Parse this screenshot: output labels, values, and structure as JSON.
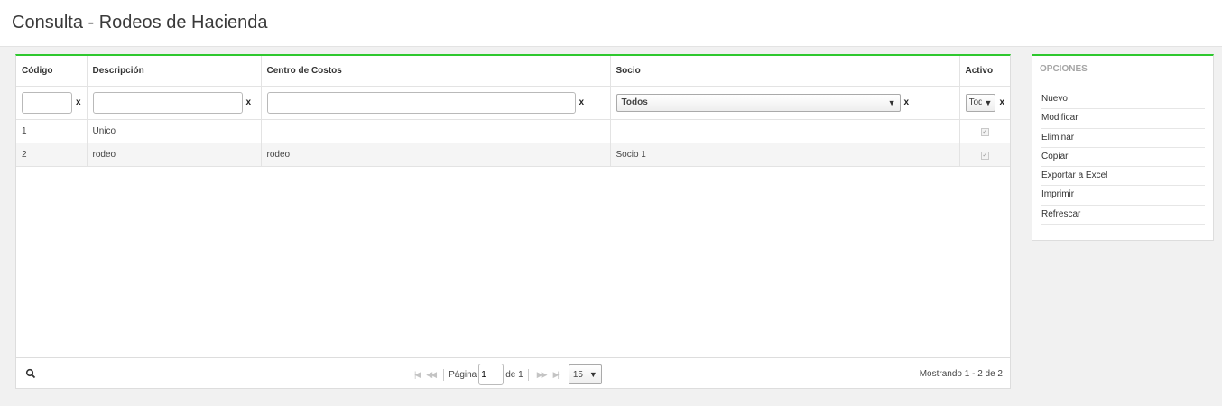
{
  "page": {
    "title": "Consulta - Rodeos de Hacienda"
  },
  "grid": {
    "columns": [
      "Código",
      "Descripción",
      "Centro de Costos",
      "Socio",
      "Activo"
    ],
    "filters": {
      "clear_label": "x",
      "socio_selected": "Todos",
      "activo_selected": "Todos"
    },
    "rows": [
      {
        "codigo": "1",
        "descripcion": "Unico",
        "centro": "",
        "socio": "",
        "activo": true
      },
      {
        "codigo": "2",
        "descripcion": "rodeo",
        "centro": "rodeo",
        "socio": "Socio 1",
        "activo": true
      }
    ],
    "pager": {
      "page_label": "Página",
      "page_value": "1",
      "of_label": "de 1",
      "page_size": "15",
      "info": "Mostrando 1 - 2 de 2"
    }
  },
  "options": {
    "title": "OPCIONES",
    "items": [
      "Nuevo",
      "Modificar",
      "Eliminar",
      "Copiar",
      "Exportar a Excel",
      "Imprimir",
      "Refrescar"
    ]
  },
  "colors": {
    "accent": "#2ec82e",
    "background": "#f1f1f1"
  },
  "icons": {
    "checkbox_mark": "✓",
    "caret": "▼",
    "search": "search-icon"
  }
}
